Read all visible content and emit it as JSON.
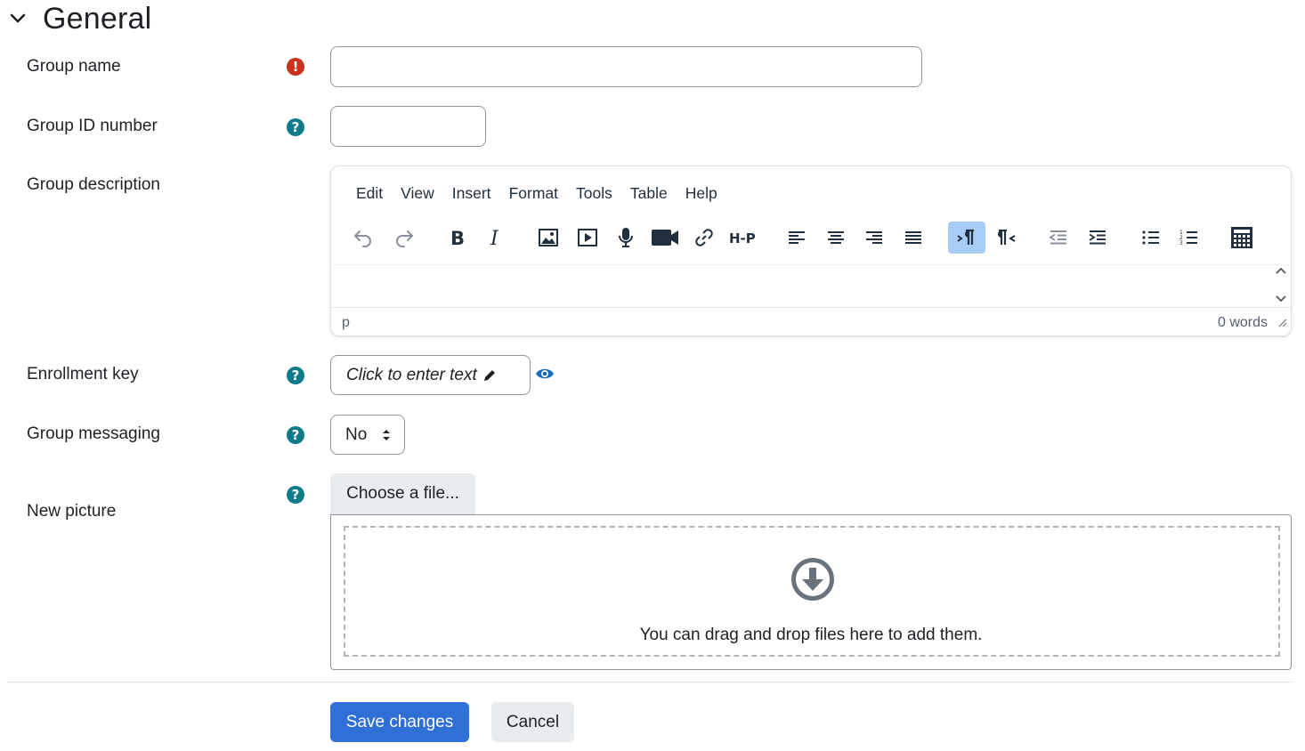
{
  "section": {
    "title": "General",
    "toggle_icon": "chevron-down-icon"
  },
  "fields": {
    "group_name": {
      "label": "Group name",
      "value": "",
      "icon": "required-icon"
    },
    "group_id": {
      "label": "Group ID number",
      "value": "",
      "icon": "help-icon"
    },
    "group_description": {
      "label": "Group description"
    },
    "enrollment_key": {
      "label": "Enrollment key",
      "value": "Click to enter text",
      "icon": "help-icon"
    },
    "group_messaging": {
      "label": "Group messaging",
      "selected": "No",
      "icon": "help-icon"
    },
    "new_picture": {
      "label": "New picture",
      "icon": "help-icon"
    }
  },
  "editor": {
    "menu": [
      "Edit",
      "View",
      "Insert",
      "Format",
      "Tools",
      "Table",
      "Help"
    ],
    "toolbar": [
      "undo-icon",
      "redo-icon",
      "bold-icon",
      "italic-icon",
      "image-icon",
      "media-icon",
      "record-audio-icon",
      "record-video-icon",
      "link-icon",
      "h5p-icon",
      "align-left-icon",
      "align-center-icon",
      "align-right-icon",
      "align-justify-icon",
      "ltr-icon",
      "rtl-icon",
      "outdent-icon",
      "indent-icon",
      "bullet-list-icon",
      "numbered-list-icon",
      "equation-calculator-icon"
    ],
    "h5p_text": "H-P",
    "active_tool": "ltr-icon",
    "status_path": "p",
    "word_count": "0 words"
  },
  "filepicker": {
    "choose_label": "Choose a file...",
    "drop_text": "You can drag and drop files here to add them."
  },
  "buttons": {
    "save": "Save changes",
    "cancel": "Cancel"
  },
  "colors": {
    "primary": "#2f6fd6",
    "required": "#ca3120",
    "help": "#0f7b8a",
    "active_tool": "#a6ccf7"
  }
}
